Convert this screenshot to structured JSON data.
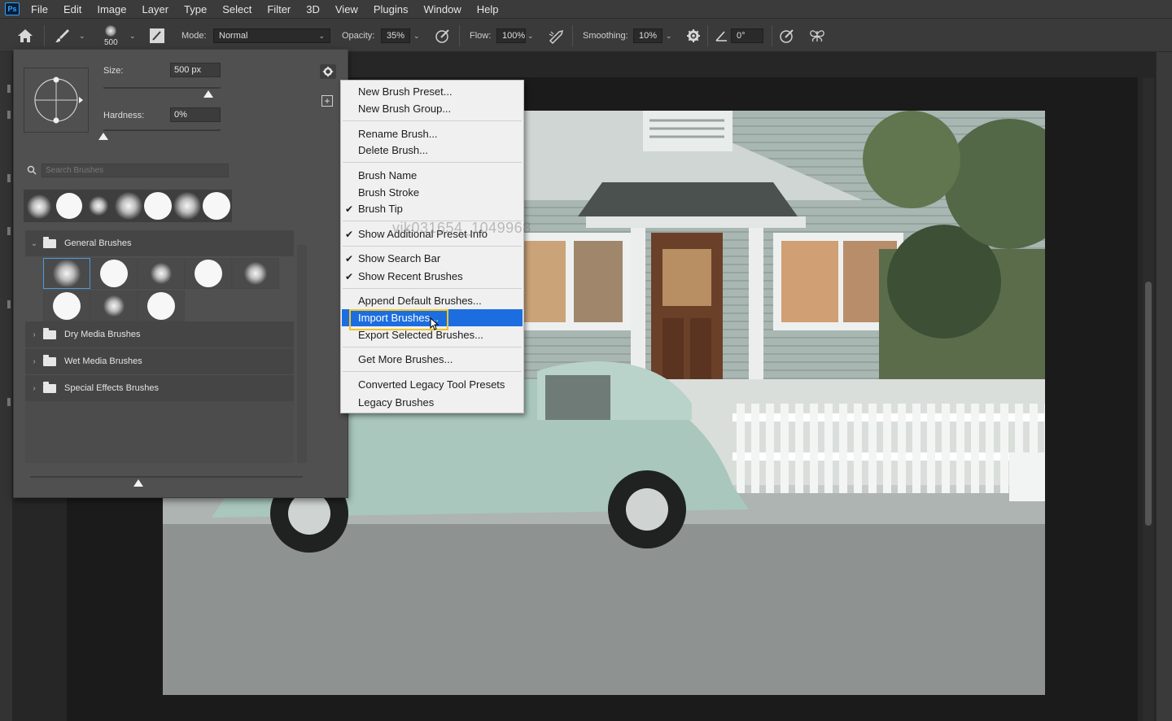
{
  "app": {
    "logo": "Ps"
  },
  "menubar": {
    "items": [
      "File",
      "Edit",
      "Image",
      "Layer",
      "Type",
      "Select",
      "Filter",
      "3D",
      "View",
      "Plugins",
      "Window",
      "Help"
    ]
  },
  "options": {
    "brush_size_label": "500",
    "mode_label": "Mode:",
    "mode_value": "Normal",
    "opacity_label": "Opacity:",
    "opacity_value": "35%",
    "flow_label": "Flow:",
    "flow_value": "100%",
    "smoothing_label": "Smoothing:",
    "smoothing_value": "10%",
    "angle_value": "0°"
  },
  "brush_panel": {
    "size_label": "Size:",
    "size_value": "500 px",
    "hardness_label": "Hardness:",
    "hardness_value": "0%",
    "search_placeholder": "Search Brushes",
    "groups": [
      {
        "name": "General Brushes",
        "expanded": true
      },
      {
        "name": "Dry Media Brushes",
        "expanded": false
      },
      {
        "name": "Wet Media Brushes",
        "expanded": false
      },
      {
        "name": "Special Effects Brushes",
        "expanded": false
      }
    ]
  },
  "context_menu": {
    "sections": [
      [
        {
          "label": "New Brush Preset...",
          "checked": false
        },
        {
          "label": "New Brush Group...",
          "checked": false
        }
      ],
      [
        {
          "label": "Rename Brush...",
          "checked": false
        },
        {
          "label": "Delete Brush...",
          "checked": false
        }
      ],
      [
        {
          "label": "Brush Name",
          "checked": false
        },
        {
          "label": "Brush Stroke",
          "checked": false
        },
        {
          "label": "Brush Tip",
          "checked": true
        }
      ],
      [
        {
          "label": "Show Additional Preset Info",
          "checked": true
        }
      ],
      [
        {
          "label": "Show Search Bar",
          "checked": true
        },
        {
          "label": "Show Recent Brushes",
          "checked": true
        }
      ],
      [
        {
          "label": "Append Default Brushes...",
          "checked": false
        },
        {
          "label": "Import Brushes...",
          "checked": false,
          "highlighted": true
        },
        {
          "label": "Export Selected Brushes...",
          "checked": false
        }
      ],
      [
        {
          "label": "Get More Brushes...",
          "checked": false
        }
      ],
      [
        {
          "label": "Converted Legacy Tool Presets",
          "checked": false
        },
        {
          "label": "Legacy Brushes",
          "checked": false
        }
      ]
    ],
    "check_glyph": "✔"
  },
  "watermark": "vik031654_1049968",
  "colors": {
    "highlight": "#1c6de0",
    "focus_box": "#f3c623"
  }
}
